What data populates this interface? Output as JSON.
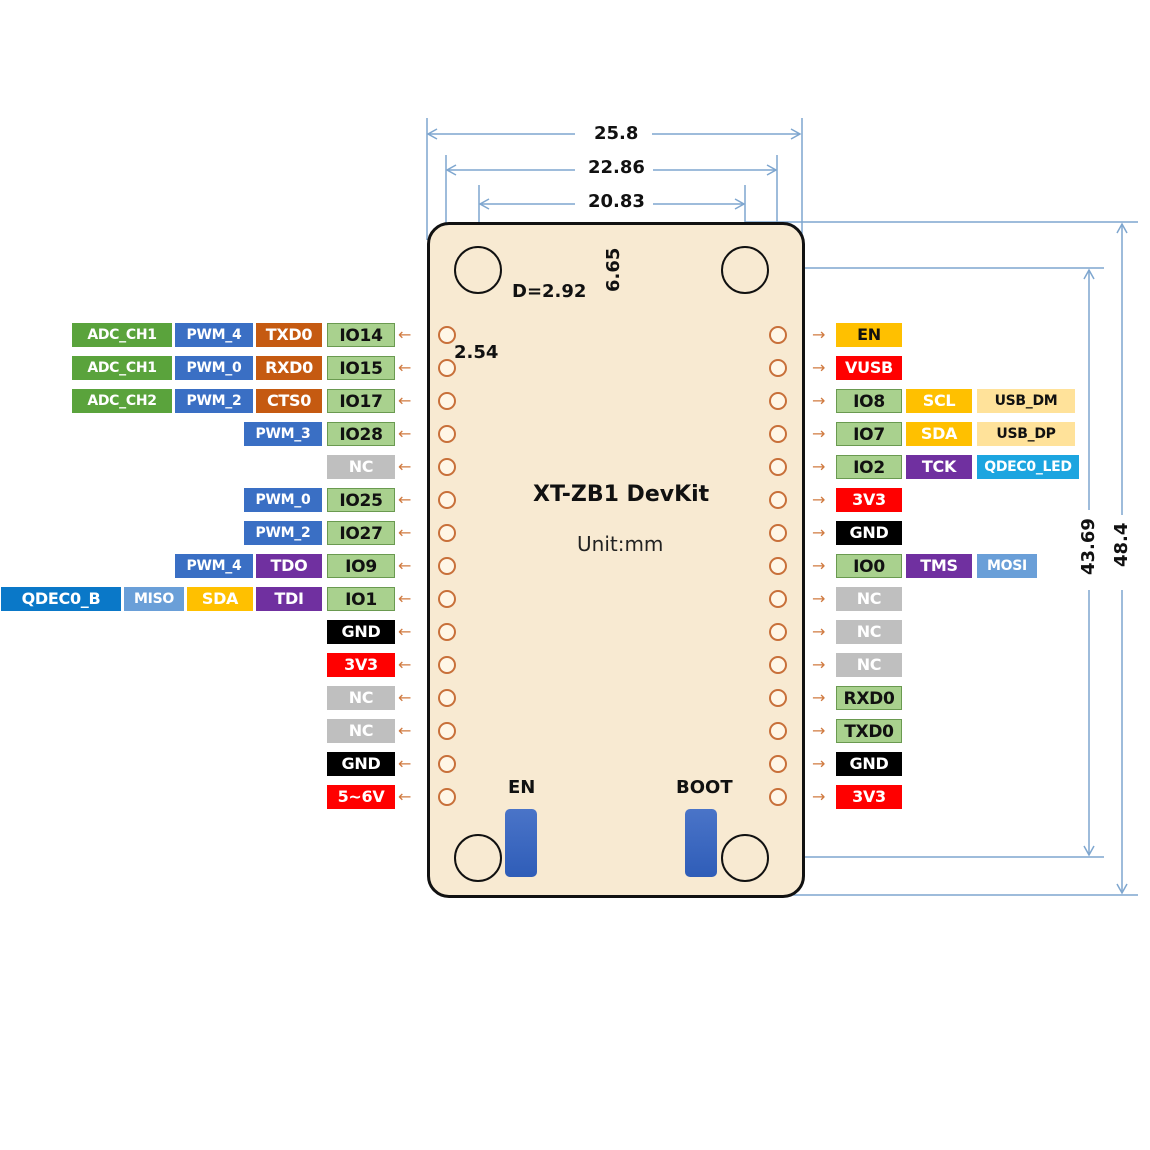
{
  "board": {
    "title": "XT-ZB1 DevKit",
    "unit": "Unit:mm",
    "buttons": [
      {
        "name": "en",
        "label": "EN"
      },
      {
        "name": "boot",
        "label": "BOOT"
      }
    ]
  },
  "dimensions": {
    "width_outer": "25.8",
    "width_holes": "22.86",
    "width_pins": "20.83",
    "hole_diameter": "D=2.92",
    "top_to_first_pin": "6.65",
    "pin_pitch": "2.54",
    "height_holes": "43.69",
    "height_outer": "48.4"
  },
  "colors": {
    "io": "#a9d18e",
    "adc": "#5aa33c",
    "pwm": "#3a6fc4",
    "uart": "#c55a11",
    "jtag": "#7030a0",
    "i2c": "#ffc000",
    "usb": "#ffe29a",
    "qdec": "#0a78c8",
    "qdec_led": "#1ca5e0",
    "spi": "#6a9fd8",
    "gnd": "#000000",
    "power": "#ff0000",
    "nc": "#bfbfbf",
    "en": "#ffc000",
    "pin_hole": "#c8703a",
    "dim_line": "#7ea6cf",
    "board_fill": "#f8ead2"
  },
  "left_pins": [
    {
      "pin": "IO14",
      "type": "io",
      "funcs": [
        {
          "t": "TXD0",
          "c": "uart"
        },
        {
          "t": "PWM_4",
          "c": "pwm"
        },
        {
          "t": "ADC_CH1",
          "c": "adc"
        }
      ]
    },
    {
      "pin": "IO15",
      "type": "io",
      "funcs": [
        {
          "t": "RXD0",
          "c": "uart"
        },
        {
          "t": "PWM_0",
          "c": "pwm"
        },
        {
          "t": "ADC_CH1",
          "c": "adc"
        }
      ]
    },
    {
      "pin": "IO17",
      "type": "io",
      "funcs": [
        {
          "t": "CTS0",
          "c": "uart"
        },
        {
          "t": "PWM_2",
          "c": "pwm"
        },
        {
          "t": "ADC_CH2",
          "c": "adc"
        }
      ]
    },
    {
      "pin": "IO28",
      "type": "io",
      "funcs": [
        {
          "t": "PWM_3",
          "c": "pwm"
        }
      ]
    },
    {
      "pin": "NC",
      "type": "nc",
      "funcs": []
    },
    {
      "pin": "IO25",
      "type": "io",
      "funcs": [
        {
          "t": "PWM_0",
          "c": "pwm"
        }
      ]
    },
    {
      "pin": "IO27",
      "type": "io",
      "funcs": [
        {
          "t": "PWM_2",
          "c": "pwm"
        }
      ]
    },
    {
      "pin": "IO9",
      "type": "io",
      "funcs": [
        {
          "t": "TDO",
          "c": "jtag"
        },
        {
          "t": "PWM_4",
          "c": "pwm"
        }
      ]
    },
    {
      "pin": "IO1",
      "type": "io",
      "funcs": [
        {
          "t": "TDI",
          "c": "jtag"
        },
        {
          "t": "SDA",
          "c": "i2c"
        },
        {
          "t": "MISO",
          "c": "spi"
        },
        {
          "t": "QDEC0_B",
          "c": "qdec"
        }
      ]
    },
    {
      "pin": "GND",
      "type": "gnd",
      "funcs": []
    },
    {
      "pin": "3V3",
      "type": "power",
      "funcs": []
    },
    {
      "pin": "NC",
      "type": "nc",
      "funcs": []
    },
    {
      "pin": "NC",
      "type": "nc",
      "funcs": []
    },
    {
      "pin": "GND",
      "type": "gnd",
      "funcs": []
    },
    {
      "pin": "5~6V",
      "type": "power",
      "funcs": []
    }
  ],
  "right_pins": [
    {
      "pin": "EN",
      "type": "en",
      "funcs": []
    },
    {
      "pin": "VUSB",
      "type": "power",
      "funcs": []
    },
    {
      "pin": "IO8",
      "type": "io",
      "funcs": [
        {
          "t": "SCL",
          "c": "i2c"
        },
        {
          "t": "USB_DM",
          "c": "usb"
        }
      ]
    },
    {
      "pin": "IO7",
      "type": "io",
      "funcs": [
        {
          "t": "SDA",
          "c": "i2c"
        },
        {
          "t": "USB_DP",
          "c": "usb"
        }
      ]
    },
    {
      "pin": "IO2",
      "type": "io",
      "funcs": [
        {
          "t": "TCK",
          "c": "jtag"
        },
        {
          "t": "QDEC0_LED",
          "c": "qdec_led"
        }
      ]
    },
    {
      "pin": "3V3",
      "type": "power",
      "funcs": []
    },
    {
      "pin": "GND",
      "type": "gnd",
      "funcs": []
    },
    {
      "pin": "IO0",
      "type": "io",
      "funcs": [
        {
          "t": "TMS",
          "c": "jtag"
        },
        {
          "t": "MOSI",
          "c": "spi"
        }
      ]
    },
    {
      "pin": "NC",
      "type": "nc",
      "funcs": []
    },
    {
      "pin": "NC",
      "type": "nc",
      "funcs": []
    },
    {
      "pin": "NC",
      "type": "nc",
      "funcs": []
    },
    {
      "pin": "RXD0",
      "type": "io",
      "funcs": []
    },
    {
      "pin": "TXD0",
      "type": "io",
      "funcs": []
    },
    {
      "pin": "GND",
      "type": "gnd",
      "funcs": []
    },
    {
      "pin": "3V3",
      "type": "power",
      "funcs": []
    }
  ]
}
